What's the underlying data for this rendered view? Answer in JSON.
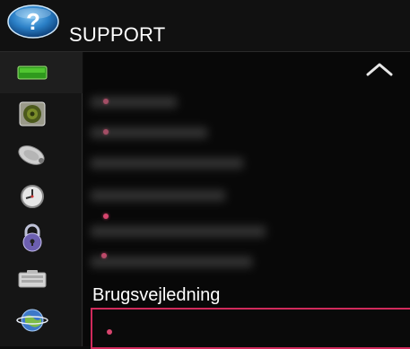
{
  "header": {
    "title": "SUPPORT",
    "help_icon": "question-mark-icon"
  },
  "sidebar": {
    "items": [
      {
        "name": "picture-icon"
      },
      {
        "name": "speaker-icon"
      },
      {
        "name": "satellite-dish-icon"
      },
      {
        "name": "clock-icon"
      },
      {
        "name": "padlock-icon"
      },
      {
        "name": "keyboard-icon"
      },
      {
        "name": "globe-icon"
      }
    ]
  },
  "menu": {
    "scroll_up_icon": "chevron-up-icon",
    "focused_item": {
      "label": "Brugsvejledning"
    }
  },
  "colors": {
    "focus_border": "#d02a5b",
    "bullet": "#d8456e",
    "background": "#0c0c0c"
  }
}
